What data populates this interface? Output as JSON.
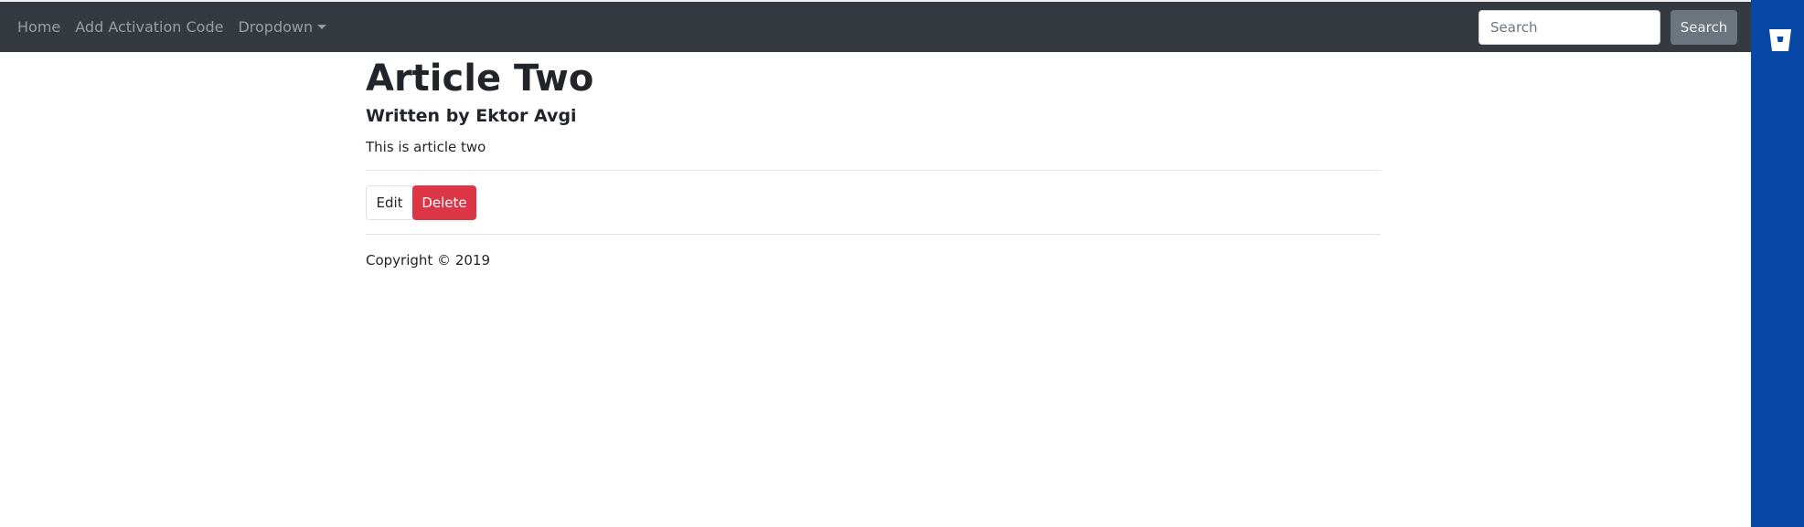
{
  "navbar": {
    "links": [
      "Home",
      "Add Activation Code",
      "Dropdown"
    ],
    "search": {
      "placeholder": "Search",
      "value": "",
      "button_label": "Search"
    }
  },
  "article": {
    "title": "Article Two",
    "author": "Written by Ektor Avgi",
    "body": "This is article two"
  },
  "actions": {
    "edit_label": "Edit",
    "delete_label": "Delete"
  },
  "footer": {
    "copyright": "Copyright © 2019"
  },
  "extension_sidebar": {
    "icon": "bitbucket-icon"
  },
  "colors": {
    "navbar_bg": "#343a40",
    "sidebar_bg": "#0747a6",
    "delete_bg": "#dc3545",
    "search_button_bg": "#6c757d"
  }
}
